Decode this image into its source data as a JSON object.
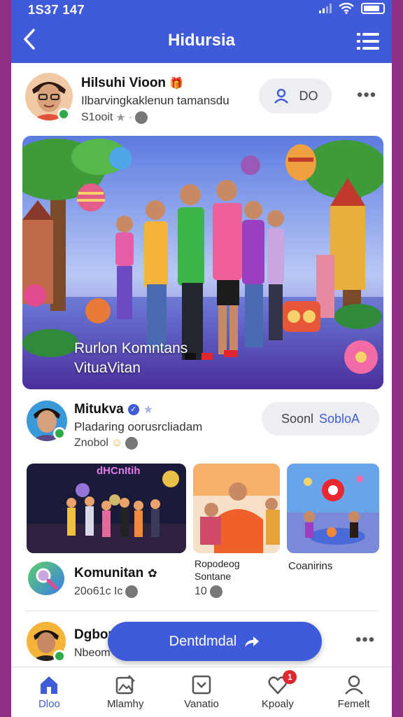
{
  "status": {
    "time": "1S37 147"
  },
  "header": {
    "title": "Hidursia"
  },
  "post1": {
    "name": "Hilsuhi Vioon",
    "subtitle": "Ilbarvingkaklenun tamansdu",
    "meta": "S1ooit",
    "pill_text": "DO"
  },
  "hero": {
    "caption_line1": "Rurlon Komntans",
    "caption_line2": "VituaVitan"
  },
  "post2": {
    "name": "Mitukva",
    "subtitle": "Pladaring oorusrcliadam",
    "meta": "Znobol",
    "pill_prefix": "Soonl",
    "pill_highlight": "Soblo",
    "pill_suffix": "A"
  },
  "thumbs": {
    "club_sign": "dHCnItih",
    "label_2_line1": "Ropodeog",
    "label_2_line2": "Sontane",
    "label_3": "Coanirins"
  },
  "community": {
    "title": "Komunitan",
    "meta": "20o61c Ic",
    "count_2": "10"
  },
  "post3": {
    "name": "Dgbou",
    "subtitle": "Nbeom"
  },
  "cta": {
    "label": "Dentdmdal"
  },
  "nav": {
    "items": [
      {
        "label": "Dloo",
        "icon": "home-icon"
      },
      {
        "label": "Mlamhy",
        "icon": "gallery-icon"
      },
      {
        "label": "Vanatio",
        "icon": "frame-icon"
      },
      {
        "label": "Kpoaly",
        "icon": "heart-icon",
        "badge": "1"
      },
      {
        "label": "Femelt",
        "icon": "profile-icon"
      }
    ]
  },
  "colors": {
    "primary": "#3f5bd9",
    "online": "#2eaa4a",
    "badge": "#e0262f",
    "frame": "#8e2f86"
  }
}
